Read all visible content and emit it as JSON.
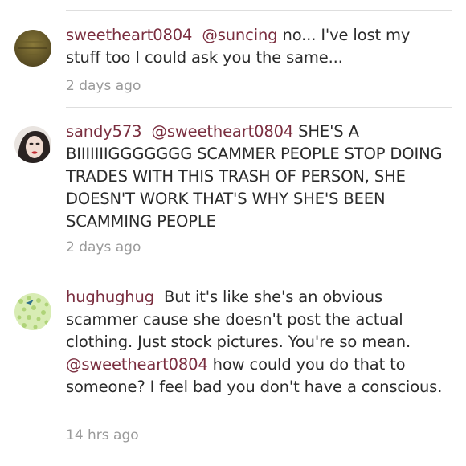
{
  "comments": [
    {
      "username": "sweetheart0804",
      "mention": "@suncing",
      "text": "no... I've lost my stuff too I could ask you the same...",
      "time": "2 days ago",
      "avatar": "olive-texture-avatar"
    },
    {
      "username": "sandy573",
      "mention": "@sweetheart0804",
      "text": "SHE'S A BIIIIIIIGGGGGGG SCAMMER PEOPLE STOP DOING TRADES WITH THIS TRASH OF PERSON, SHE DOESN'T WORK THAT'S WHY SHE'S BEEN SCAMMING PEOPLE",
      "time": "2 days ago",
      "avatar": "portrait-avatar"
    },
    {
      "username": "hughughug",
      "text_before": "But it's like she's an obvious scammer cause she doesn't post the actual clothing. Just stock pictures. You're so mean.",
      "mention": "@sweetheart0804",
      "text_after": "how could you do that to someone? I feel bad you don't have a conscious.",
      "time": "14 hrs ago",
      "avatar": "green-floral-avatar"
    }
  ],
  "colors": {
    "username": "#7a2e3f",
    "timestamp": "#9a9a9a",
    "divider": "#dedede"
  }
}
